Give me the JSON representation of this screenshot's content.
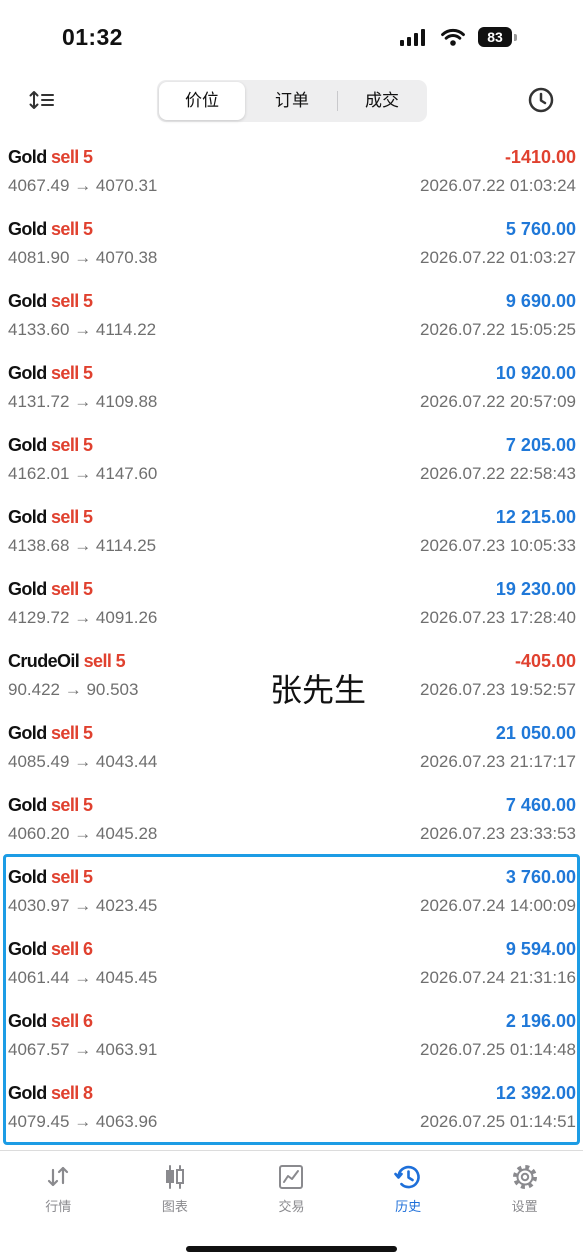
{
  "status_bar": {
    "time": "01:32",
    "battery_level": "83",
    "icons": [
      "signal-icon",
      "wifi-icon",
      "battery-icon"
    ]
  },
  "toolbar": {
    "left_icon": "sort-icon",
    "segments": [
      {
        "label": "价位",
        "selected": true
      },
      {
        "label": "订单",
        "selected": false
      },
      {
        "label": "成交",
        "selected": false
      }
    ],
    "right_icon": "clock-icon"
  },
  "labels": {
    "price_arrow": "→"
  },
  "trades": [
    {
      "symbol": "Gold",
      "side": "sell",
      "volume": "5",
      "profit": "-1410.00",
      "open_price": "4067.49",
      "close_price": "4070.31",
      "close_time": "2026.07.22 01:03:24",
      "highlighted": false
    },
    {
      "symbol": "Gold",
      "side": "sell",
      "volume": "5",
      "profit": "5 760.00",
      "open_price": "4081.90",
      "close_price": "4070.38",
      "close_time": "2026.07.22 01:03:27",
      "highlighted": false
    },
    {
      "symbol": "Gold",
      "side": "sell",
      "volume": "5",
      "profit": "9 690.00",
      "open_price": "4133.60",
      "close_price": "4114.22",
      "close_time": "2026.07.22 15:05:25",
      "highlighted": false
    },
    {
      "symbol": "Gold",
      "side": "sell",
      "volume": "5",
      "profit": "10 920.00",
      "open_price": "4131.72",
      "close_price": "4109.88",
      "close_time": "2026.07.22 20:57:09",
      "highlighted": false
    },
    {
      "symbol": "Gold",
      "side": "sell",
      "volume": "5",
      "profit": "7 205.00",
      "open_price": "4162.01",
      "close_price": "4147.60",
      "close_time": "2026.07.22 22:58:43",
      "highlighted": false
    },
    {
      "symbol": "Gold",
      "side": "sell",
      "volume": "5",
      "profit": "12 215.00",
      "open_price": "4138.68",
      "close_price": "4114.25",
      "close_time": "2026.07.23 10:05:33",
      "highlighted": false
    },
    {
      "symbol": "Gold",
      "side": "sell",
      "volume": "5",
      "profit": "19 230.00",
      "open_price": "4129.72",
      "close_price": "4091.26",
      "close_time": "2026.07.23 17:28:40",
      "highlighted": false
    },
    {
      "symbol": "CrudeOil",
      "side": "sell",
      "volume": "5",
      "profit": "-405.00",
      "open_price": "90.422",
      "close_price": "90.503",
      "close_time": "2026.07.23 19:52:57",
      "highlighted": false
    },
    {
      "symbol": "Gold",
      "side": "sell",
      "volume": "5",
      "profit": "21 050.00",
      "open_price": "4085.49",
      "close_price": "4043.44",
      "close_time": "2026.07.23 21:17:17",
      "highlighted": false
    },
    {
      "symbol": "Gold",
      "side": "sell",
      "volume": "5",
      "profit": "7 460.00",
      "open_price": "4060.20",
      "close_price": "4045.28",
      "close_time": "2026.07.23 23:33:53",
      "highlighted": false
    },
    {
      "symbol": "Gold",
      "side": "sell",
      "volume": "5",
      "profit": "3 760.00",
      "open_price": "4030.97",
      "close_price": "4023.45",
      "close_time": "2026.07.24 14:00:09",
      "highlighted": true
    },
    {
      "symbol": "Gold",
      "side": "sell",
      "volume": "6",
      "profit": "9 594.00",
      "open_price": "4061.44",
      "close_price": "4045.45",
      "close_time": "2026.07.24 21:31:16",
      "highlighted": true
    },
    {
      "symbol": "Gold",
      "side": "sell",
      "volume": "6",
      "profit": "2 196.00",
      "open_price": "4067.57",
      "close_price": "4063.91",
      "close_time": "2026.07.25 01:14:48",
      "highlighted": true
    },
    {
      "symbol": "Gold",
      "side": "sell",
      "volume": "8",
      "profit": "12 392.00",
      "open_price": "4079.45",
      "close_price": "4063.96",
      "close_time": "2026.07.25 01:14:51",
      "highlighted": true
    }
  ],
  "watermark": "张先生",
  "bottom_nav": {
    "items": [
      {
        "label": "行情",
        "icon": "quotes-arrows-icon",
        "active": false
      },
      {
        "label": "图表",
        "icon": "chart-candlestick-icon",
        "active": false
      },
      {
        "label": "交易",
        "icon": "trade-chart-icon",
        "active": false
      },
      {
        "label": "历史",
        "icon": "history-icon",
        "active": true
      },
      {
        "label": "设置",
        "icon": "settings-gear-icon",
        "active": false
      }
    ]
  },
  "colors": {
    "profit_positive": "#1f78d8",
    "profit_negative": "#e0412f",
    "side_sell": "#e0412f",
    "highlight_border": "#1c9ce5",
    "nav_active": "#1e6fd9",
    "nav_inactive": "#8a8a8e"
  }
}
